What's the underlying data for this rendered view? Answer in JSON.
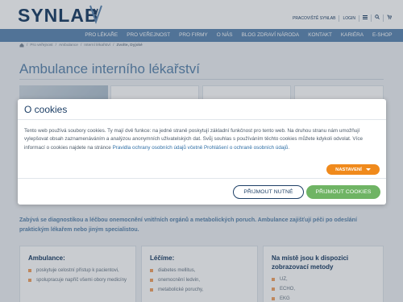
{
  "brand": {
    "name": "SYNLAB"
  },
  "toplinks": [
    "PRACOVIŠTĚ SYNLAB",
    "LOGIN"
  ],
  "nav": [
    "PRO LÉKAŘE",
    "PRO VEŘEJNOST",
    "PRO FIRMY",
    "O NÁS",
    "BLOG ZDRAVÍ NÁRODA",
    "KONTAKT",
    "KARIÉRA",
    "E-SHOP"
  ],
  "breadcrumb": [
    "Pro veřejnost",
    "Ambulance",
    "Interní lékařství",
    "Zvolte, Dyjské"
  ],
  "page": {
    "title": "Ambulance interního lékařství",
    "intro": "Zabývá se diagnostikou a léčbou onemocnění vnitřních orgánů a metabolických poruch. Ambulance zajišťují péči po odeslání praktickým lékařem nebo jiným specialistou."
  },
  "columns": [
    {
      "heading": "Ambulance:",
      "items": [
        "poskytuje celostní přístup k pacientovi,",
        "spolupracuje napříč všemi obory medicíny"
      ]
    },
    {
      "heading": "Léčíme:",
      "items": [
        "diabetes mellitus,",
        "onemocnění ledvin,",
        "metabolické poruchy,"
      ]
    },
    {
      "heading": "Na místě jsou k dispozici zobrazovací metody",
      "items": [
        "UZ,",
        "ECHO,",
        "EKG"
      ]
    }
  ],
  "cookie_modal": {
    "title": "O cookies",
    "text_before_links": "Tento web používá soubory cookies. Ty mají dvě funkce: na jedné straně poskytují základní funkčnost pro tento web. Na druhou stranu nám umožňují vylepšovat obsah zaznamenáváním a analýzou anonymních uživatelských dat. Svůj souhlas s používáním těchto cookies můžete kdykoli odvolat. Více informací o cookies najdete na stránce ",
    "link1": "Pravidla ochrany osobních údajů včetně Prohlášení o ochraně osobních údajů",
    "text_after_links": ".",
    "settings_label": "NASTAVENÍ",
    "necessary_label": "PŘIJMOUT NUTNÉ",
    "accept_all_label": "PŘIJMOUT COOKIES"
  },
  "colors": {
    "brand_dark": "#1d3f66",
    "nav_blue": "#5f88b3",
    "accent_orange": "#f08a1c",
    "accept_green": "#6fb464"
  }
}
